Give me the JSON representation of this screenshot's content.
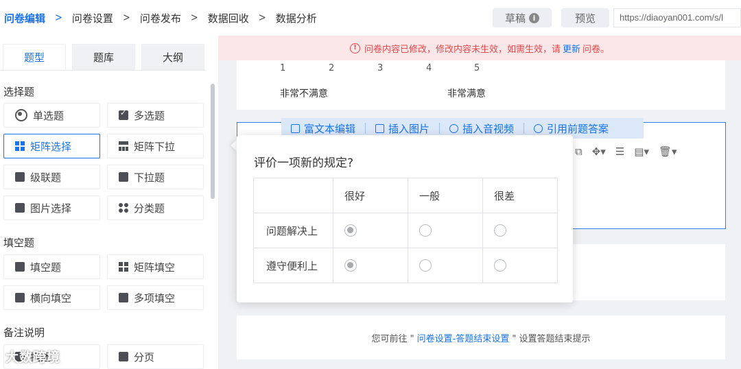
{
  "breadcrumb": [
    "问卷编辑",
    "问卷设置",
    "问卷发布",
    "数据回收",
    "数据分析"
  ],
  "topright": {
    "draft_label": "草稿",
    "preview_label": "预览",
    "url": "https://diaoyan001.com/s/l"
  },
  "left": {
    "tabs": [
      "题型",
      "题库",
      "大纲"
    ],
    "sections": [
      {
        "title": "选择题",
        "items": [
          "单选题",
          "多选题",
          "矩阵选择",
          "矩阵下拉",
          "级联题",
          "下拉题",
          "图片选择",
          "分类题"
        ]
      },
      {
        "title": "填空题",
        "items": [
          "填空题",
          "矩阵填空",
          "横向填空",
          "多项填空"
        ]
      },
      {
        "title": "备注说明",
        "items": [
          "描述",
          "分页"
        ]
      }
    ]
  },
  "banner": {
    "before": "问卷内容已修改，修改内容未生效，如需生效，请",
    "link": "更新",
    "after": "问卷。"
  },
  "scale": {
    "numbers": [
      "1",
      "2",
      "3",
      "4",
      "5"
    ],
    "low_label": "非常不满意",
    "high_label": "非常满意"
  },
  "toolbar": [
    "富文本编辑",
    "插入图片",
    "插入音视频",
    "引用前题答案"
  ],
  "popup": {
    "title": "评价一项新的规定?",
    "columns": [
      "很好",
      "一般",
      "很差"
    ],
    "rows": [
      {
        "label": "问题解决上",
        "selected": 0
      },
      {
        "label": "遵守便利上",
        "selected": 0
      }
    ]
  },
  "footer_hint": {
    "before": "您可前往 \"",
    "link": "问卷设置-答题结束设置",
    "after": "\" 设置答题结束提示"
  },
  "watermark": "大数跨境"
}
